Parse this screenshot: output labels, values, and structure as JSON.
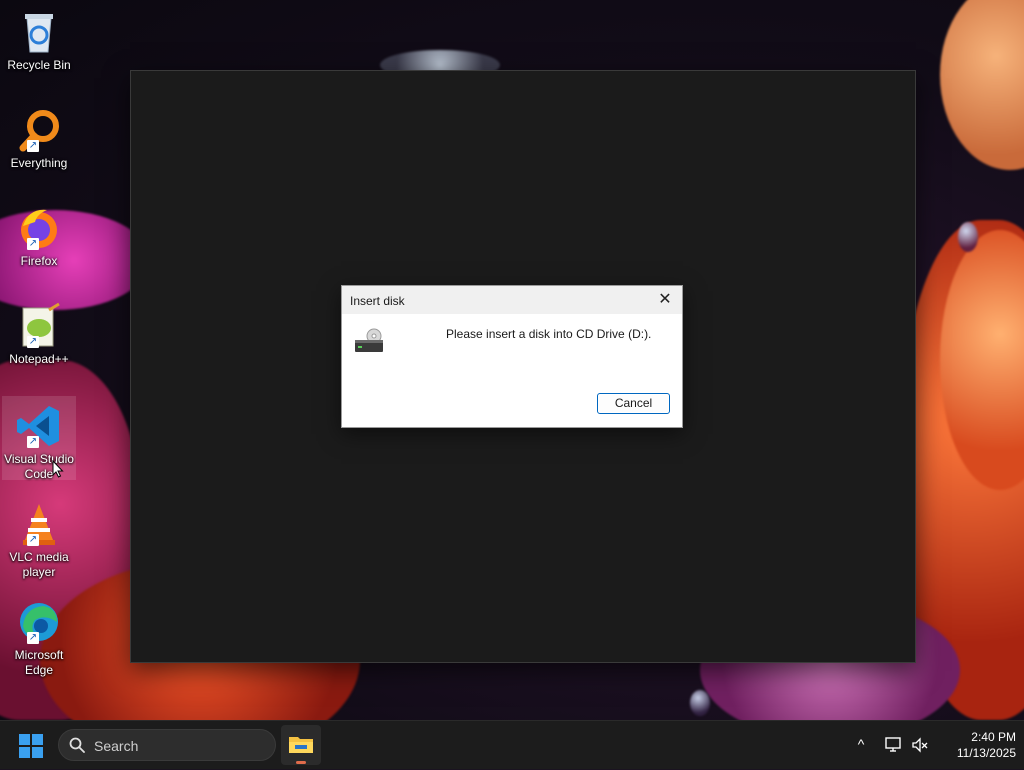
{
  "desktop": {
    "icons": [
      {
        "label": "Recycle Bin",
        "icon": "recycle-bin-icon"
      },
      {
        "label": "Everything",
        "icon": "everything-search-icon"
      },
      {
        "label": "Firefox",
        "icon": "firefox-icon"
      },
      {
        "label": "Notepad++",
        "icon": "notepadpp-icon"
      },
      {
        "label": "Visual Studio Code",
        "icon": "vscode-icon"
      },
      {
        "label": "VLC media player",
        "icon": "vlc-icon"
      },
      {
        "label": "Microsoft Edge",
        "icon": "edge-icon"
      }
    ]
  },
  "dialog": {
    "title": "Insert disk",
    "close_label": "✕",
    "message": "Please insert a disk into CD Drive (D:).",
    "cancel_label": "Cancel"
  },
  "taskbar": {
    "search_placeholder": "Search",
    "tray_chevron": "^",
    "time": "2:40 PM",
    "date": "11/13/2025"
  },
  "colors": {
    "accent": "#0067c0",
    "taskbar_bg": "#1c1c1c",
    "window_bg": "#1b1b1b"
  }
}
